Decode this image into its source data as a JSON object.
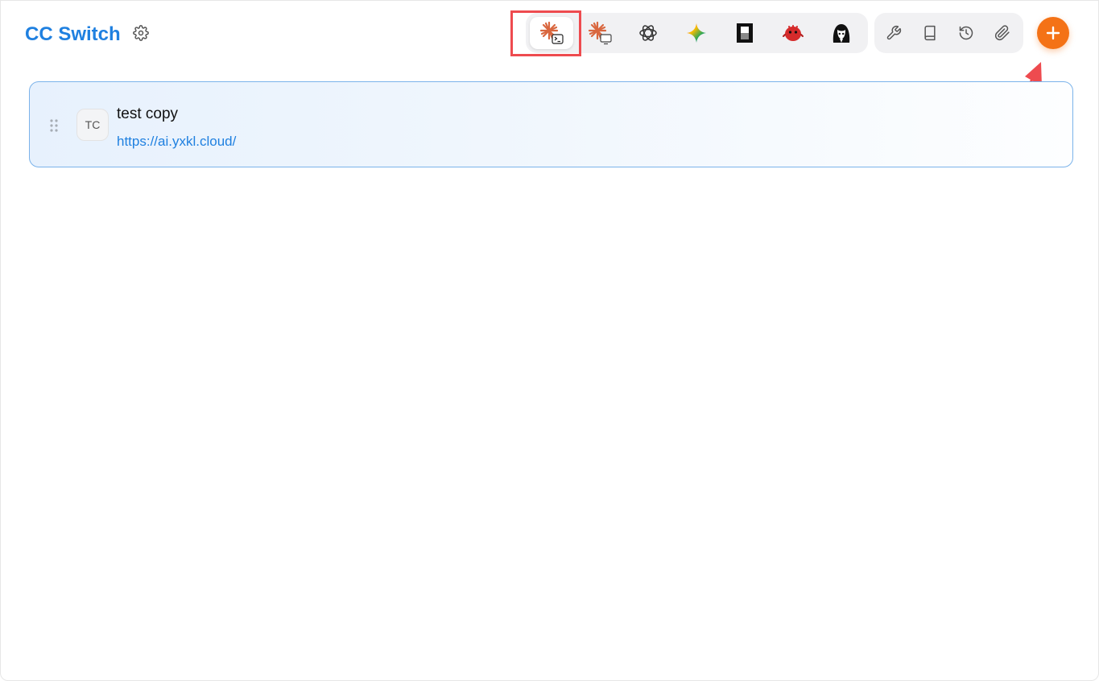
{
  "header": {
    "title": "CC Switch",
    "settings_icon": "gear-icon"
  },
  "app_switcher": {
    "tabs": [
      {
        "name": "claude-code",
        "icon": "claude-terminal-icon",
        "active": true
      },
      {
        "name": "claude-desktop",
        "icon": "claude-desktop-icon",
        "active": false
      },
      {
        "name": "openai",
        "icon": "openai-icon",
        "active": false
      },
      {
        "name": "gemini",
        "icon": "gemini-icon",
        "active": false
      },
      {
        "name": "opencode",
        "icon": "opencode-icon",
        "active": false
      },
      {
        "name": "red-bird",
        "icon": "red-bird-icon",
        "active": false
      },
      {
        "name": "anime-avatar",
        "icon": "anime-avatar-icon",
        "active": false
      }
    ]
  },
  "tools": [
    {
      "name": "wrench",
      "icon": "wrench-icon"
    },
    {
      "name": "book",
      "icon": "book-icon"
    },
    {
      "name": "history",
      "icon": "history-icon"
    },
    {
      "name": "attachment",
      "icon": "paperclip-icon"
    }
  ],
  "add_button": {
    "icon": "plus-icon"
  },
  "providers": [
    {
      "initials": "TC",
      "name": "test copy",
      "url": "https://ai.yxkl.cloud/"
    }
  ],
  "colors": {
    "brand": "#1f80e0",
    "accent": "#f47216",
    "annotation": "#ee4b4f",
    "card_border": "#7bb3ea"
  }
}
